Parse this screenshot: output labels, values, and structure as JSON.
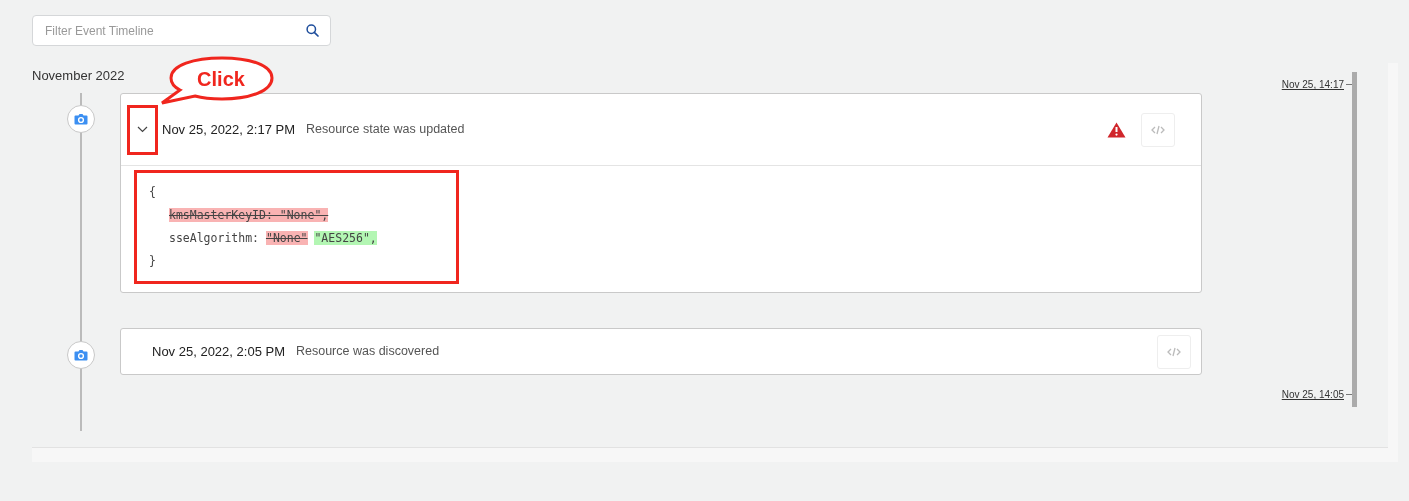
{
  "search": {
    "placeholder": "Filter Event Timeline"
  },
  "month": "November 2022",
  "events": [
    {
      "time": "Nov 25, 2022, 2:17 PM",
      "description": "Resource state was updated",
      "expanded": true,
      "warning": true,
      "diff": {
        "open": "{",
        "close": "}",
        "lines": [
          {
            "kind": "removed",
            "text": "kmsMasterKeyID: \"None\","
          },
          {
            "kind": "changed",
            "key": "sseAlgorithm:",
            "old": "\"None\"",
            "new": "\"AES256\","
          }
        ]
      }
    },
    {
      "time": "Nov 25, 2022, 2:05 PM",
      "description": "Resource was discovered",
      "expanded": false,
      "warning": false
    }
  ],
  "scrubber": {
    "labels": [
      "Nov 25, 14:17",
      "Nov 25, 14:05"
    ]
  },
  "annotation": {
    "callout": "Click"
  }
}
